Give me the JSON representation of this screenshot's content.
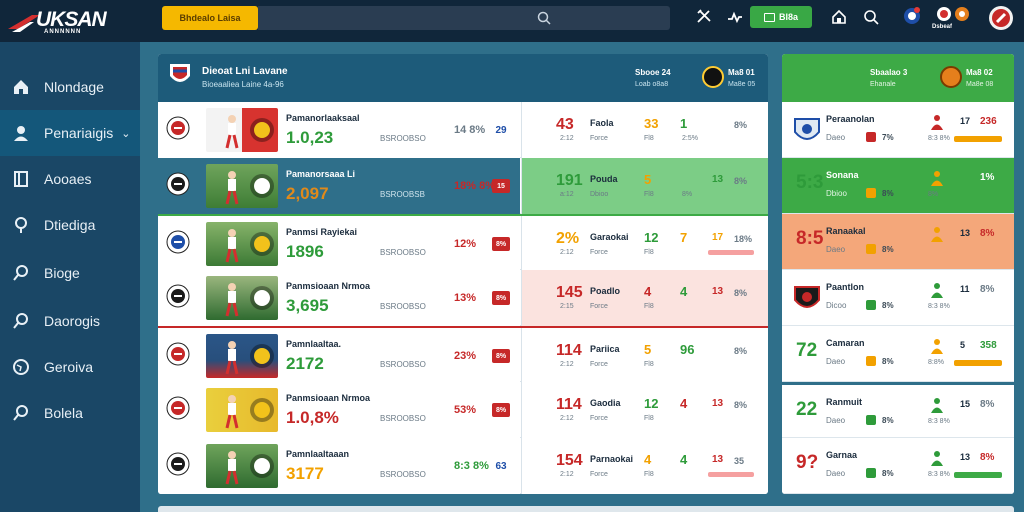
{
  "brand": {
    "name": "UKSAN",
    "tagline": "ANNNNNN"
  },
  "header": {
    "promo_label": "Bhdealo Laisa",
    "search_placeholder": "",
    "wallet_label": "Bl8a",
    "profile_label": "Dsbeaf"
  },
  "sidebar": {
    "items": [
      {
        "label": "Nlondage",
        "icon": "home-icon"
      },
      {
        "label": "Penariaigis",
        "icon": "user-icon",
        "active": true
      },
      {
        "label": "Aooaes",
        "icon": "board-icon"
      },
      {
        "label": "Dtiediga",
        "icon": "location-icon"
      },
      {
        "label": "Bioge",
        "icon": "search-icon"
      },
      {
        "label": "Daorogis",
        "icon": "search-icon"
      },
      {
        "label": "Geroiva",
        "icon": "globe-icon"
      },
      {
        "label": "Bolela",
        "icon": "search-icon"
      }
    ]
  },
  "matches_panel": {
    "title": "Dieoat Lni Lavane",
    "subtitle": "Bioeaaliea Laine 4a-96",
    "right_top_a": "Sbooe 24",
    "right_sub_a": "Loab o8a8",
    "right_top_b": "Ma8 01",
    "right_sub_b": "Ma8e 05",
    "rows": [
      {
        "title": "Pamanorlaaksaal",
        "score": "1.0,23",
        "score_color": "#2e9b3a",
        "meta": "BSROOBSO",
        "pct": "14 8%",
        "pct_color": "#6b7a86",
        "tag": "29",
        "tag_style": "plain",
        "r_big": "43",
        "r_big_color": "#c62828",
        "r_small": "2:12",
        "r_tag": "Faola",
        "r_sub": "Force",
        "v1": "33",
        "v1_color": "#f2a100",
        "v1s": "Fl8",
        "v2": "1",
        "v2_color": "#2e9b3a",
        "v2s": "2:5%",
        "v3": "",
        "v4": "8%",
        "bar": false
      },
      {
        "title": "Pamanorsaaa Li",
        "score": "2,097",
        "score_color": "#e08a1a",
        "meta": "BSROOBSB",
        "pct": "18% 8%",
        "pct_color": "#c62828",
        "tag": "15",
        "tag_style": "solid",
        "r_big": "191",
        "r_big_color": "#2e9b3a",
        "r_small": "a:12",
        "r_tag": "Pouda",
        "r_sub": "Dbioo",
        "v1": "5",
        "v1_color": "#f2a100",
        "v1s": "Fl8",
        "v2": "",
        "v2_color": "#2e9b3a",
        "v2s": "8%",
        "v3": "13",
        "v4": "8%",
        "bar": false
      },
      {
        "title": "Panmsi Rayiekai",
        "score": "1896",
        "score_color": "#2e9b3a",
        "meta": "BSROOBSO",
        "pct": "12%",
        "pct_color": "#c62828",
        "tag": "8%",
        "tag_style": "solid",
        "r_big": "2%",
        "r_big_color": "#f2a100",
        "r_small": "2:12",
        "r_tag": "Garaokai",
        "r_sub": "Force",
        "v1": "12",
        "v1_color": "#2e9b3a",
        "v1s": "Fl8",
        "v2": "7",
        "v2_color": "#f2a100",
        "v2s": "",
        "v3": "17",
        "v4": "18%",
        "bar": true
      },
      {
        "title": "Panmsioaan Nrmoa",
        "score": "3,695",
        "score_color": "#2e9b3a",
        "meta": "BSROOBSO",
        "pct": "13%",
        "pct_color": "#c62828",
        "tag": "8%",
        "tag_style": "solid",
        "r_big": "145",
        "r_big_color": "#c62828",
        "r_small": "2:15",
        "r_tag": "Poadlo",
        "r_sub": "Force",
        "v1": "4",
        "v1_color": "#c62828",
        "v1s": "Fl8",
        "v2": "4",
        "v2_color": "#2e9b3a",
        "v2s": "",
        "v3": "13",
        "v4": "8%",
        "bar": false
      },
      {
        "title": "Pamnlaaltaa.",
        "score": "2172",
        "score_color": "#2e9b3a",
        "meta": "BSROOBSO",
        "pct": "23%",
        "pct_color": "#c62828",
        "tag": "8%",
        "tag_style": "solid",
        "r_big": "114",
        "r_big_color": "#c62828",
        "r_small": "2:12",
        "r_tag": "Pariica",
        "r_sub": "Force",
        "v1": "5",
        "v1_color": "#f2a100",
        "v1s": "Fl8",
        "v2": "96",
        "v2_color": "#2e9b3a",
        "v2s": "",
        "v3": "",
        "v4": "8%",
        "bar": false
      },
      {
        "title": "Panmsioaan Nrmoa",
        "score": "1.0,8%",
        "score_color": "#c62828",
        "meta": "BSROOBSO",
        "pct": "53%",
        "pct_color": "#c62828",
        "tag": "8%",
        "tag_style": "solid",
        "r_big": "114",
        "r_big_color": "#c62828",
        "r_small": "2:12",
        "r_tag": "Gaodia",
        "r_sub": "Force",
        "v1": "12",
        "v1_color": "#2e9b3a",
        "v1s": "Fl8",
        "v2": "4",
        "v2_color": "#c62828",
        "v2s": "",
        "v3": "13",
        "v4": "8%",
        "bar": false
      },
      {
        "title": "Pamnlaaltaaan",
        "score": "3177",
        "score_color": "#f2a100",
        "meta": "BSROOBSO",
        "pct": "8:3 8%",
        "pct_color": "#2e9b3a",
        "tag": "63",
        "tag_style": "plain",
        "r_big": "154",
        "r_big_color": "#c62828",
        "r_small": "2:12",
        "r_tag": "Parnaokai",
        "r_sub": "Force",
        "v1": "4",
        "v1_color": "#f2a100",
        "v1s": "Fl8",
        "v2": "4",
        "v2_color": "#2e9b3a",
        "v2s": "",
        "v3": "13",
        "v4": "35",
        "bar": true
      }
    ]
  },
  "side_panel": {
    "head_a": "Sbaalao 3",
    "head_sub_a": "Ehanale",
    "head_b": "Ma8 02",
    "head_sub_b": "Ma8e 08",
    "rows": [
      {
        "big": "",
        "title": "Peraanolan",
        "sub": "Daeo",
        "pct": "7%",
        "dot_color": "#c62828",
        "m2": "8:3 8%",
        "v1": "17",
        "v2": "236",
        "v2_color": "#c62828",
        "bar_color": "#f2a100"
      },
      {
        "big": "5:3",
        "big_color": "#2e9b3a",
        "title": "Sonana",
        "sub": "Dbioo",
        "pct": "8%",
        "dot_color": "#f2a100",
        "m2": "8%",
        "v1": "",
        "v2": "1%",
        "v2_color": "#2e9b3a",
        "bar_color": ""
      },
      {
        "big": "8:5",
        "big_color": "#c62828",
        "title": "Ranaakal",
        "sub": "Daeo",
        "pct": "8%",
        "dot_color": "#f2a100",
        "m2": "",
        "v1": "13",
        "v2": "8%",
        "v2_color": "#c62828",
        "bar_color": ""
      },
      {
        "big": "",
        "title": "Paantlon",
        "sub": "Dicoo",
        "pct": "8%",
        "dot_color": "#2e9b3a",
        "m2": "8:3 8%",
        "v1": "11",
        "v2": "8%",
        "v2_color": "#6b7a86",
        "bar_color": ""
      },
      {
        "big": "72",
        "big_color": "#2e9b3a",
        "title": "Camaran",
        "sub": "Daeo",
        "pct": "8%",
        "dot_color": "#f2a100",
        "m2": "8:8%",
        "v1": "5",
        "v2": "358",
        "v2_color": "#2e9b3a",
        "bar_color": "#f2a100"
      },
      {
        "big": "22",
        "big_color": "#2e9b3a",
        "title": "Ranmuit",
        "sub": "Daeo",
        "pct": "8%",
        "dot_color": "#2e9b3a",
        "m2": "8:3 8%",
        "v1": "15",
        "v2": "8%",
        "v2_color": "#6b7a86",
        "bar_color": ""
      },
      {
        "big": "9?",
        "big_color": "#c62828",
        "title": "Garnaa",
        "sub": "Daeo",
        "pct": "8%",
        "dot_color": "#2e9b3a",
        "m2": "8:3 8%",
        "v1": "13",
        "v2": "8%",
        "v2_color": "#c62828",
        "bar_color": "#3daa46"
      }
    ]
  }
}
